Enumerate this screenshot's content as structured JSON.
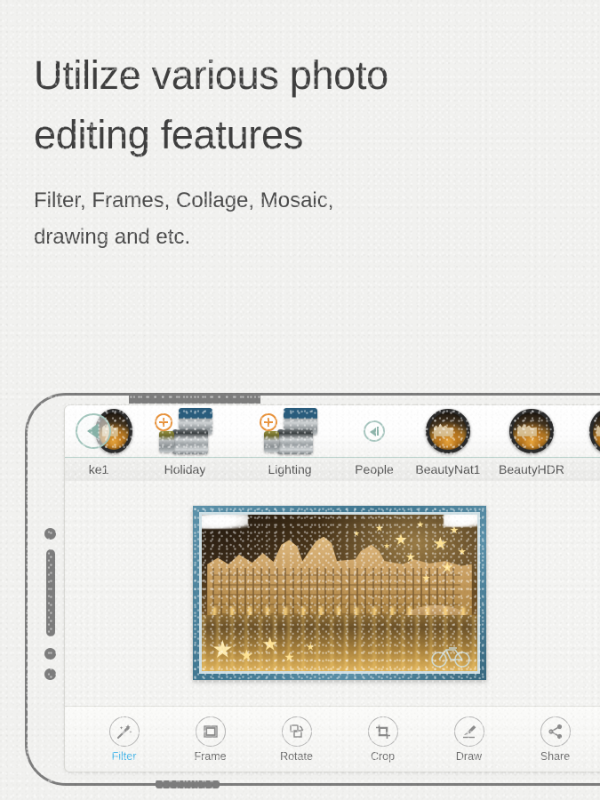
{
  "promo": {
    "headline": "Utilize various photo\nediting features",
    "subline": "Filter, Frames, Collage, Mosaic,\ndrawing and etc."
  },
  "theme": {
    "page_background": "#f1f1ef",
    "headline_color": "#3f3f3f",
    "subline_color": "#4a4a4a",
    "phone_outline": "#7d7d7d",
    "accent_blue": "#4fb9ea",
    "accent_orange": "#e8923a",
    "accent_teal": "#87b2a8",
    "frame_blue": "#3f7690"
  },
  "app": {
    "carousel": {
      "nav_arrow_icon": "chevron-left-circle-icon",
      "items": [
        {
          "label": "ke1",
          "icon": "round-photo-thumb",
          "badge": "",
          "type": "photo"
        },
        {
          "label": "Holiday",
          "icon": "camera-lens-pack",
          "badge": "plus-download-badge",
          "type": "pack"
        },
        {
          "label": "Lighting",
          "icon": "camera-lens-pack",
          "badge": "plus-download-badge",
          "type": "pack"
        },
        {
          "label": "People",
          "icon": "collapse-left-circle-icon",
          "badge": "",
          "type": "collapse"
        },
        {
          "label": "BeautyNat1",
          "icon": "round-photo-thumb",
          "badge": "",
          "type": "photo"
        },
        {
          "label": "BeautyHDR",
          "icon": "round-photo-thumb",
          "badge": "",
          "type": "photo"
        },
        {
          "label": "",
          "icon": "round-photo-thumb",
          "badge": "",
          "type": "photo"
        }
      ]
    },
    "preview": {
      "photo_alt": "Night city castle by river with golden lights",
      "frame_style": "blue-teal bordered frame",
      "overlay_effects": [
        "stars",
        "clouds",
        "bicycle"
      ]
    },
    "toolbar": {
      "active": "Filter",
      "items": [
        {
          "label": "Filter",
          "icon": "magic-wand-icon"
        },
        {
          "label": "Frame",
          "icon": "frame-square-icon"
        },
        {
          "label": "Rotate",
          "icon": "rotate-icon"
        },
        {
          "label": "Crop",
          "icon": "crop-icon"
        },
        {
          "label": "Draw",
          "icon": "brush-icon"
        },
        {
          "label": "Share",
          "icon": "share-nodes-icon"
        }
      ]
    }
  }
}
